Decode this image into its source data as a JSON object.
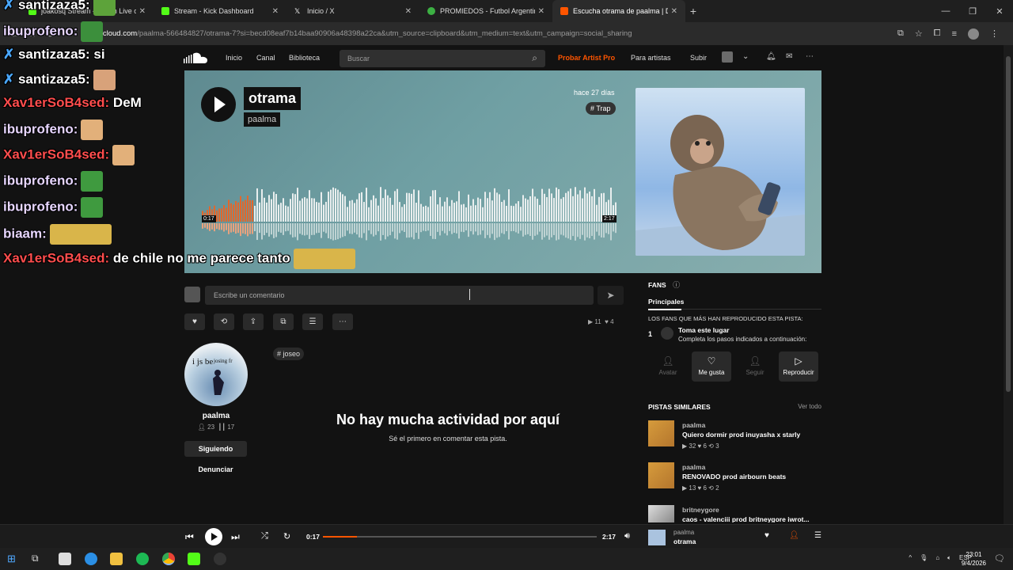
{
  "browser": {
    "tabs": [
      {
        "title": "joakosq Stream - Watch Live on",
        "icon": "kick-icon",
        "color": "#53fc18"
      },
      {
        "title": "Stream - Kick Dashboard",
        "icon": "kick-icon",
        "color": "#53fc18"
      },
      {
        "title": "Inicio / X",
        "icon": "x-icon",
        "color": "#ffffff"
      },
      {
        "title": "PROMIEDOS - Futbol Argentino",
        "icon": "promiedos-icon",
        "color": "#3cb043"
      },
      {
        "title": "Escucha otrama de paalma | De",
        "icon": "soundcloud-icon",
        "color": "#ff5500"
      }
    ],
    "url_domain": "soundcloud.com",
    "url_path": "/paalma-566484827/otrama-7?si=becd08eaf7b14baa90906a48398a22ca&utm_source=clipboard&utm_medium=text&utm_campaign=social_sharing"
  },
  "header": {
    "nav": [
      "Inicio",
      "Canal",
      "Biblioteca"
    ],
    "search_placeholder": "Buscar",
    "pro_label": "Probar Artist Pro",
    "for_artists": "Para artistas",
    "upload": "Subir"
  },
  "track": {
    "title": "otrama",
    "artist": "paalma",
    "posted": "hace 27 días",
    "genre": "# Trap",
    "current_time": "0:17",
    "duration": "2:17",
    "progress": 0.124,
    "plays": "11",
    "likes": "4"
  },
  "comment": {
    "placeholder": "Escribe un comentario"
  },
  "profile": {
    "name": "paalma",
    "followers": "23",
    "tracks": "17",
    "following_label": "Siguiendo",
    "report_label": "Denunciar",
    "image_text": "i js be",
    "image_text2": "josing fr"
  },
  "tag": "# joseo",
  "empty": {
    "title": "No hay mucha actividad por aquí",
    "subtitle": "Sé el primero en comentar esta pista."
  },
  "fans": {
    "heading": "FANS",
    "tab": "Principales",
    "subheading": "LOS FANS QUE MÁS HAN REPRODUCIDO ESTA PISTA:",
    "rank": "1",
    "cta_title": "Toma este lugar",
    "cta_desc": "Completa los pasos indicados a continuación:",
    "steps": [
      "Avatar",
      "Me gusta",
      "Seguir",
      "Reproducir"
    ]
  },
  "similar": {
    "heading": "PISTAS SIMILARES",
    "view_all": "Ver todo",
    "items": [
      {
        "artist": "paalma",
        "title": "Quiero dormir prod inuyasha x starly",
        "stats": "▶ 32  ♥ 6  ⟲ 3"
      },
      {
        "artist": "paalma",
        "title": "RENOVADO prod airbourn beats",
        "stats": "▶ 13  ♥ 6  ⟲ 2"
      },
      {
        "artist": "britneygore",
        "title": "caos - valenciii prod britneygore iwrot...",
        "stats": ""
      }
    ]
  },
  "chat": [
    {
      "user": "santizaza5:",
      "color": "#ffffff",
      "msg": "",
      "badge": true
    },
    {
      "user": "ibuprofeno:",
      "color": "#e7d6ff",
      "msg": "",
      "badge": false
    },
    {
      "user": "santizaza5:",
      "color": "#ffffff",
      "msg": " si",
      "badge": true
    },
    {
      "user": "santizaza5:",
      "color": "#ffffff",
      "msg": "",
      "badge": true
    },
    {
      "user": "Xav1erSoB4sed:",
      "color": "#ff4d4d",
      "msg": " DeM",
      "badge": false
    },
    {
      "user": "ibuprofeno:",
      "color": "#e7d6ff",
      "msg": "",
      "badge": false
    },
    {
      "user": "Xav1erSoB4sed:",
      "color": "#ff4d4d",
      "msg": "",
      "badge": false
    },
    {
      "user": "ibuprofeno:",
      "color": "#e7d6ff",
      "msg": "",
      "badge": false
    },
    {
      "user": "ibuprofeno:",
      "color": "#e7d6ff",
      "msg": "",
      "badge": false
    },
    {
      "user": "biaam:",
      "color": "#e7d6ff",
      "msg": "",
      "badge": false
    },
    {
      "user": "Xav1erSoB4sed:",
      "color": "#ff4d4d",
      "msg": " de chile no me parece tanto",
      "badge": false
    }
  ],
  "taskbar": {
    "lang": "ESP",
    "time": "23:01",
    "date": "9/4/2026"
  }
}
